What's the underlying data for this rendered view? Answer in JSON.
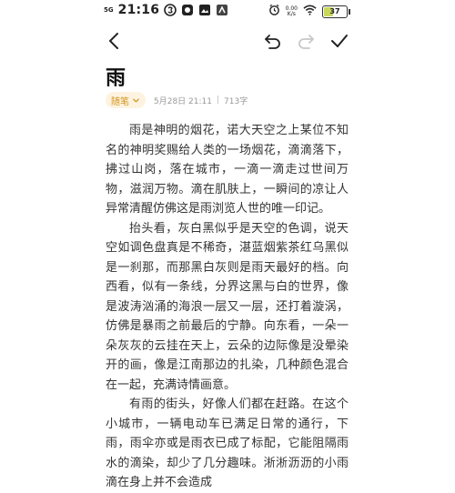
{
  "status_bar": {
    "signal": "5G",
    "time": "21:16",
    "net_speed": "0.00\nK/s",
    "battery": "37",
    "battery_level": 0.37,
    "icons": [
      "signal-icon",
      "soul-app-icon",
      "app-icon",
      "gallery-icon",
      "kuaishou-icon",
      "alarm-icon",
      "wifi-icon",
      "battery-icon"
    ]
  },
  "toolbar": {
    "back_icon": "chevron-left-icon",
    "undo_icon": "undo-icon",
    "redo_icon": "redo-icon",
    "done_icon": "check-icon"
  },
  "note": {
    "title": "雨",
    "category": "随笔",
    "date": "5月28日 21:11",
    "separator": "|",
    "word_count": "713字",
    "paragraphs": [
      "雨是神明的烟花，诺大天空之上某位不知名的神明奖赐给人类的一场烟花，滴滴落下，拂过山岗，落在城市，一滴一滴走过世间万物，滋润万物。滴在肌肤上，一瞬间的凉让人异常清醒仿佛这是雨浏览人世的唯一印记。",
      "抬头看，灰白黑似乎是天空的色调，说天空如调色盘真是不稀奇，湛蓝烟紫茶红乌黑似是一刹那，而那黑白灰则是雨天最好的档。向西看，似有一条线，分界这黑与白的世界，像是波涛汹涌的海浪一层又一层，还打着漩涡，仿佛是暴雨之前最后的宁静。向东看，一朵一朵灰灰的云挂在天上，云朵的边际像是没晕染开的画，像是江南那边的扎染，几种颜色混合在一起，充满诗情画意。",
      "有雨的街头，好像人们都在赶路。在这个小城市，一辆电动车已满足日常的通行，下雨，雨伞亦或是雨衣已成了标配，它能阻隔雨水的滴染，却少了几分趣味。淅淅沥沥的小雨滴在身上并不会造成"
    ]
  },
  "colors": {
    "accent": "#d4931a",
    "accent_bg": "#fdf3e0",
    "text": "#333333",
    "meta": "#999999"
  }
}
